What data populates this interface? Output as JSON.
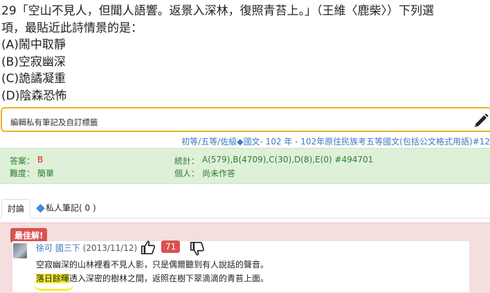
{
  "question": {
    "line1": "29「空山不見人，但聞人語響。返景入深林，復照青苔上。」（王維〈鹿柴〉）下列選",
    "line2": "項，最貼近此詩情景的是：",
    "options": [
      "(A)鬧中取靜",
      "(B)空寂幽深",
      "(C)詭譎凝重",
      "(D)陰森恐怖"
    ]
  },
  "note_bar": {
    "placeholder": "編輯私有筆記及自訂標籤",
    "icon": "pencil-icon"
  },
  "meta_line": "初等/五等/佐級◆國文- 102 年 - 102年原住民族考五等國文(包括公文格式用語)#12",
  "stats": {
    "answer_label": "答案：",
    "answer_value": "B",
    "difficulty_label": "難度：",
    "difficulty_value": "簡單",
    "tally_label": "統計：",
    "tally_value": "A(579),B(4709),C(30),D(8),E(0) #494701",
    "personal_label": "個人：",
    "personal_value": "尚未作答"
  },
  "tabs": [
    {
      "label": "討論"
    },
    {
      "label": "私人筆記( 0 )"
    }
  ],
  "discussion": {
    "best_badge": "最佳解!",
    "author": "徐可",
    "grade": "國三下",
    "date": "(2013/11/12)",
    "likes": "71",
    "line1": "空寂幽深的山林裡看不見人影，只是偶爾聽到有人說話的聲音。",
    "line2_highlight": "落日餘暉",
    "line2_rest": "透入深密的樹林之間，返照在樹下翠滴滴的青苔上面。"
  },
  "colors": {
    "accent_orange": "#f0b020",
    "link_blue": "#3a78c0",
    "badge_red": "#d9534f",
    "stats_green": "#dff0d8",
    "highlight": "#f5ee30"
  }
}
